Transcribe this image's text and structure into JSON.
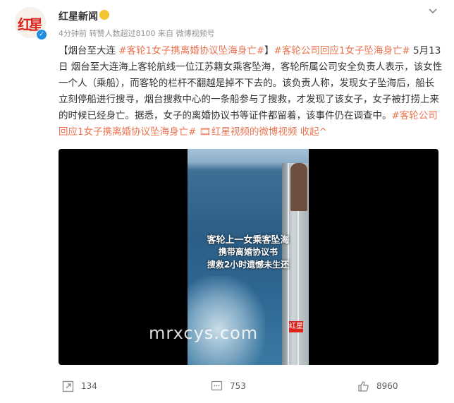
{
  "account": {
    "avatar_text": "红星",
    "name": "红星新闻",
    "verified_icon": "verified-badge-icon",
    "meta": "4分钟前 转赞人数超过8100  来自 微博视频号"
  },
  "post": {
    "seg1": "【烟台至大连 ",
    "tag1": "#客轮1女子携离婚协议坠海身亡#",
    "seg2": "】",
    "tag2": "#客轮公司回应1女子坠海身亡#",
    "body": " 5月13日 烟台至大连海上客轮航线一位江苏籍女乘客坠海，客轮所属公司安全负责人表示，该女性一个人（乘船），而客轮的栏杆不翻越是掉不下去的。该负责人称，发现女子坠海后，船长立刻停船进行搜寻，烟台搜救中心的一条船参与了搜救，才发现了该女子，女子被打捞上来的时候已经身亡。据悉，女子的离婚协议书等证件都留着，该事件仍在调查中。",
    "tag3": "#客轮公司回应1女子携离婚协议坠海身亡#",
    "video_link": " 🎞红星视频的微博视频",
    "collapse": " 收起^"
  },
  "video": {
    "caption1": "客轮上一女乘客坠海",
    "caption2": "携带离婚协议书",
    "caption3": "搜救2小时遗憾未生还",
    "logo": "红星",
    "watermark": "mrxcys.com"
  },
  "actions": {
    "share_count": "134",
    "comment_count": "753",
    "like_count": "8960"
  },
  "colors": {
    "accent": "#eb7350",
    "text": "#333333",
    "meta": "#939393"
  }
}
